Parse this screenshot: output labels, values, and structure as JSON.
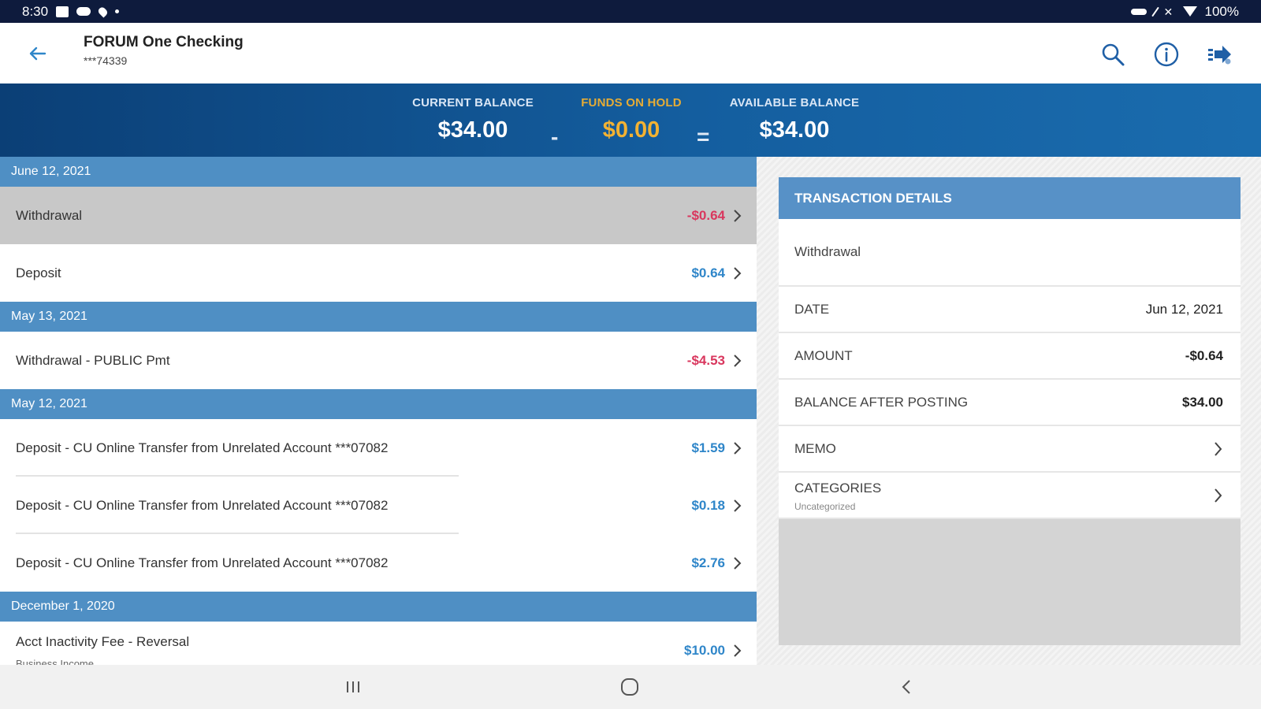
{
  "status_bar": {
    "time": "8:30",
    "battery": "100%"
  },
  "header": {
    "title": "FORUM One Checking",
    "account_number": "***74339",
    "icons": [
      "back-arrow-icon",
      "search-icon",
      "info-icon",
      "transfer-icon"
    ]
  },
  "balances": {
    "current_label": "CURRENT BALANCE",
    "current_value": "$34.00",
    "minus": "-",
    "hold_label": "FUNDS ON HOLD",
    "hold_value": "$0.00",
    "equals": "=",
    "available_label": "AVAILABLE BALANCE",
    "available_value": "$34.00"
  },
  "groups": [
    {
      "date": "June 12, 2021",
      "transactions": [
        {
          "description": "Withdrawal",
          "amount": "-$0.64",
          "sign": "neg"
        },
        {
          "description": "Deposit",
          "amount": "$0.64",
          "sign": "pos"
        }
      ]
    },
    {
      "date": "May 13, 2021",
      "transactions": [
        {
          "description": "Withdrawal - PUBLIC Pmt",
          "amount": "-$4.53",
          "sign": "neg"
        }
      ]
    },
    {
      "date": "May 12, 2021",
      "transactions": [
        {
          "description": "Deposit - CU Online Transfer from Unrelated Account ***07082",
          "amount": "$1.59",
          "sign": "pos"
        },
        {
          "description": "Deposit - CU Online Transfer from Unrelated Account ***07082",
          "amount": "$0.18",
          "sign": "pos"
        },
        {
          "description": "Deposit - CU Online Transfer from Unrelated Account ***07082",
          "amount": "$2.76",
          "sign": "pos"
        }
      ]
    },
    {
      "date": "December 1, 2020",
      "transactions": [
        {
          "description": "Acct Inactivity Fee - Reversal",
          "category": "Business Income",
          "amount": "$10.00",
          "sign": "pos"
        }
      ]
    }
  ],
  "details": {
    "header": "TRANSACTION DETAILS",
    "description": "Withdrawal",
    "date_label": "DATE",
    "date_value": "Jun 12, 2021",
    "amount_label": "AMOUNT",
    "amount_value": "-$0.64",
    "balance_label": "BALANCE AFTER POSTING",
    "balance_value": "$34.00",
    "memo_label": "MEMO",
    "categories_label": "CATEGORIES",
    "categories_value": "Uncategorized"
  },
  "nav": {
    "icons": [
      "recent-apps-icon",
      "home-icon",
      "system-back-icon"
    ]
  },
  "colors": {
    "banner": "#145e9f",
    "date_header": "#4f8fc4",
    "negative": "#d9375e",
    "positive": "#2f86c9",
    "hold": "#f2b233"
  }
}
